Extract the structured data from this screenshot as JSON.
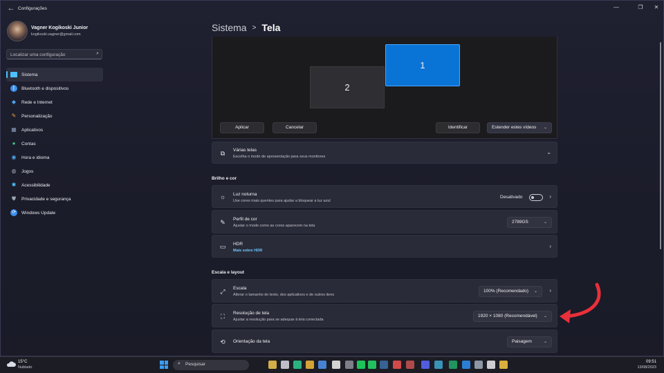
{
  "window": {
    "title": "Configurações",
    "controls": [
      "minimize",
      "maximize",
      "close"
    ]
  },
  "profile": {
    "name": "Vagner Kogikoski Junior",
    "email": "kogikoski.vagner@gmail.com"
  },
  "search": {
    "placeholder": "Localizar uma configuração",
    "icon": "search-icon"
  },
  "sidebar": {
    "items": [
      {
        "label": "Sistema",
        "icon": "monitor-icon",
        "color": "#4cc2ff",
        "active": true
      },
      {
        "label": "Bluetooth e dispositivos",
        "icon": "bluetooth-icon",
        "color": "#3b8eea"
      },
      {
        "label": "Rede e Internet",
        "icon": "wifi-icon",
        "color": "#4ca3e8"
      },
      {
        "label": "Personalização",
        "icon": "brush-icon",
        "color": "#e8a24c"
      },
      {
        "label": "Aplicativos",
        "icon": "apps-icon",
        "color": "#8a9ab8"
      },
      {
        "label": "Contas",
        "icon": "person-icon",
        "color": "#3ec48b"
      },
      {
        "label": "Hora e idioma",
        "icon": "globe-clock-icon",
        "color": "#4ca3e8"
      },
      {
        "label": "Jogos",
        "icon": "gamepad-icon",
        "color": "#a0a8b8"
      },
      {
        "label": "Acessibilidade",
        "icon": "accessibility-icon",
        "color": "#4cc2ff"
      },
      {
        "label": "Privacidade e segurança",
        "icon": "shield-icon",
        "color": "#9aa4b4"
      },
      {
        "label": "Windows Update",
        "icon": "update-icon",
        "color": "#3b8eea"
      }
    ]
  },
  "breadcrumb": {
    "parent": "Sistema",
    "separator": ">",
    "current": "Tela"
  },
  "preview": {
    "monitors": [
      {
        "number": "1",
        "selected": true
      },
      {
        "number": "2",
        "selected": false
      }
    ],
    "apply": "Aplicar",
    "cancel": "Cancelar",
    "identify": "Identificar",
    "extend": "Estender estes vídeos"
  },
  "multiple": {
    "title": "Várias telas",
    "subtitle": "Escolha o modo de apresentação para seus monitores"
  },
  "brightness": {
    "section": "Brilho e cor",
    "night": {
      "title": "Luz noturna",
      "subtitle": "Use cores mais quentes para ajudar a bloquear a luz azul",
      "state": "Desativado"
    },
    "profile": {
      "title": "Perfil de cor",
      "subtitle": "Ajustar o modo como as cores aparecem na tela",
      "value": "2789GS"
    },
    "hdr": {
      "title": "HDR",
      "subtitle": "Mais sobre HDR"
    }
  },
  "scale": {
    "section": "Escala e layout",
    "escala": {
      "title": "Escala",
      "subtitle": "Alterar o tamanho do texto, dos aplicativos e de outros itens",
      "value": "100% (Recomendado)"
    },
    "resolution": {
      "title": "Resolução de tela",
      "subtitle": "Ajustar a resolução para se adequar à tela conectada",
      "value": "1920 × 1080 (Recomendável)"
    },
    "orientation": {
      "title": "Orientação da tela",
      "value": "Paisagem"
    }
  },
  "annotation": {
    "color": "#e8303a"
  },
  "taskbar": {
    "weather": {
      "temp": "15°C",
      "condition": "Nublado"
    },
    "search": "Pesquisar",
    "clock": {
      "time": "09:51",
      "date": "13/08/2023"
    },
    "apps": [
      {
        "name": "start-icon",
        "color": "#3b9cf0"
      },
      {
        "name": "widgets-icon",
        "color": "#e8c04c"
      },
      {
        "name": "task-view-icon",
        "color": "#d0d0d8"
      },
      {
        "name": "edge-icon",
        "color": "#2ec28b"
      },
      {
        "name": "chrome-icon",
        "color": "#e8b33a"
      },
      {
        "name": "photos-icon",
        "color": "#4c8ee8"
      },
      {
        "name": "notion-icon",
        "color": "#e8e8e8"
      },
      {
        "name": "grid-icon",
        "color": "#8a8a95"
      },
      {
        "name": "spotify-icon",
        "color": "#1ed760"
      },
      {
        "name": "whatsapp-icon",
        "color": "#25d366"
      },
      {
        "name": "steam-icon",
        "color": "#3b6aa0"
      },
      {
        "name": "controller-icon",
        "color": "#e85050"
      },
      {
        "name": "game-icon",
        "color": "#c05050"
      },
      {
        "name": "discord-icon",
        "color": "#5865f2"
      },
      {
        "name": "k-icon",
        "color": "#3fa0c8"
      },
      {
        "name": "excel-icon",
        "color": "#21a366"
      },
      {
        "name": "vscode-icon",
        "color": "#2f8ae8"
      },
      {
        "name": "settings-icon",
        "color": "#9aa4b4"
      },
      {
        "name": "snip-icon",
        "color": "#e0e0e6"
      },
      {
        "name": "explorer-icon",
        "color": "#f0c040"
      }
    ]
  }
}
